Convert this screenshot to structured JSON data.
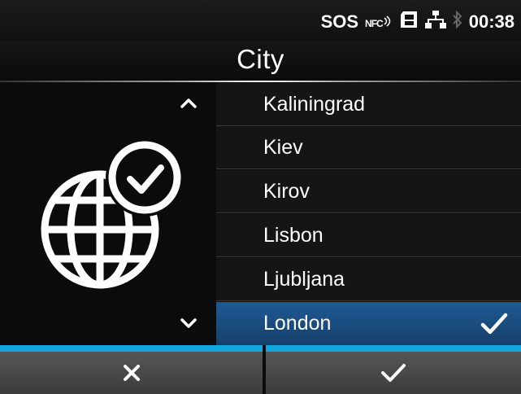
{
  "status": {
    "sos": "SOS",
    "nfc": "NFC",
    "time": "00:38"
  },
  "header": {
    "title": "City"
  },
  "icons": {
    "status": [
      "nfc-icon",
      "sd-card-icon",
      "network-icon",
      "bluetooth-icon"
    ],
    "panel": [
      "globe-clock-icon",
      "scroll-up-icon",
      "scroll-down-icon"
    ],
    "footer": [
      "cancel-x-icon",
      "confirm-check-icon"
    ]
  },
  "list": {
    "items": [
      {
        "label": "Kaliningrad"
      },
      {
        "label": "Kiev"
      },
      {
        "label": "Kirov"
      },
      {
        "label": "Lisbon"
      },
      {
        "label": "Ljubljana"
      },
      {
        "label": "London"
      }
    ],
    "selected_index": 5
  },
  "colors": {
    "accent_blue": "#13a7e0",
    "selected_row": "#1e5a94",
    "footer_button": "#4a4a4a"
  }
}
